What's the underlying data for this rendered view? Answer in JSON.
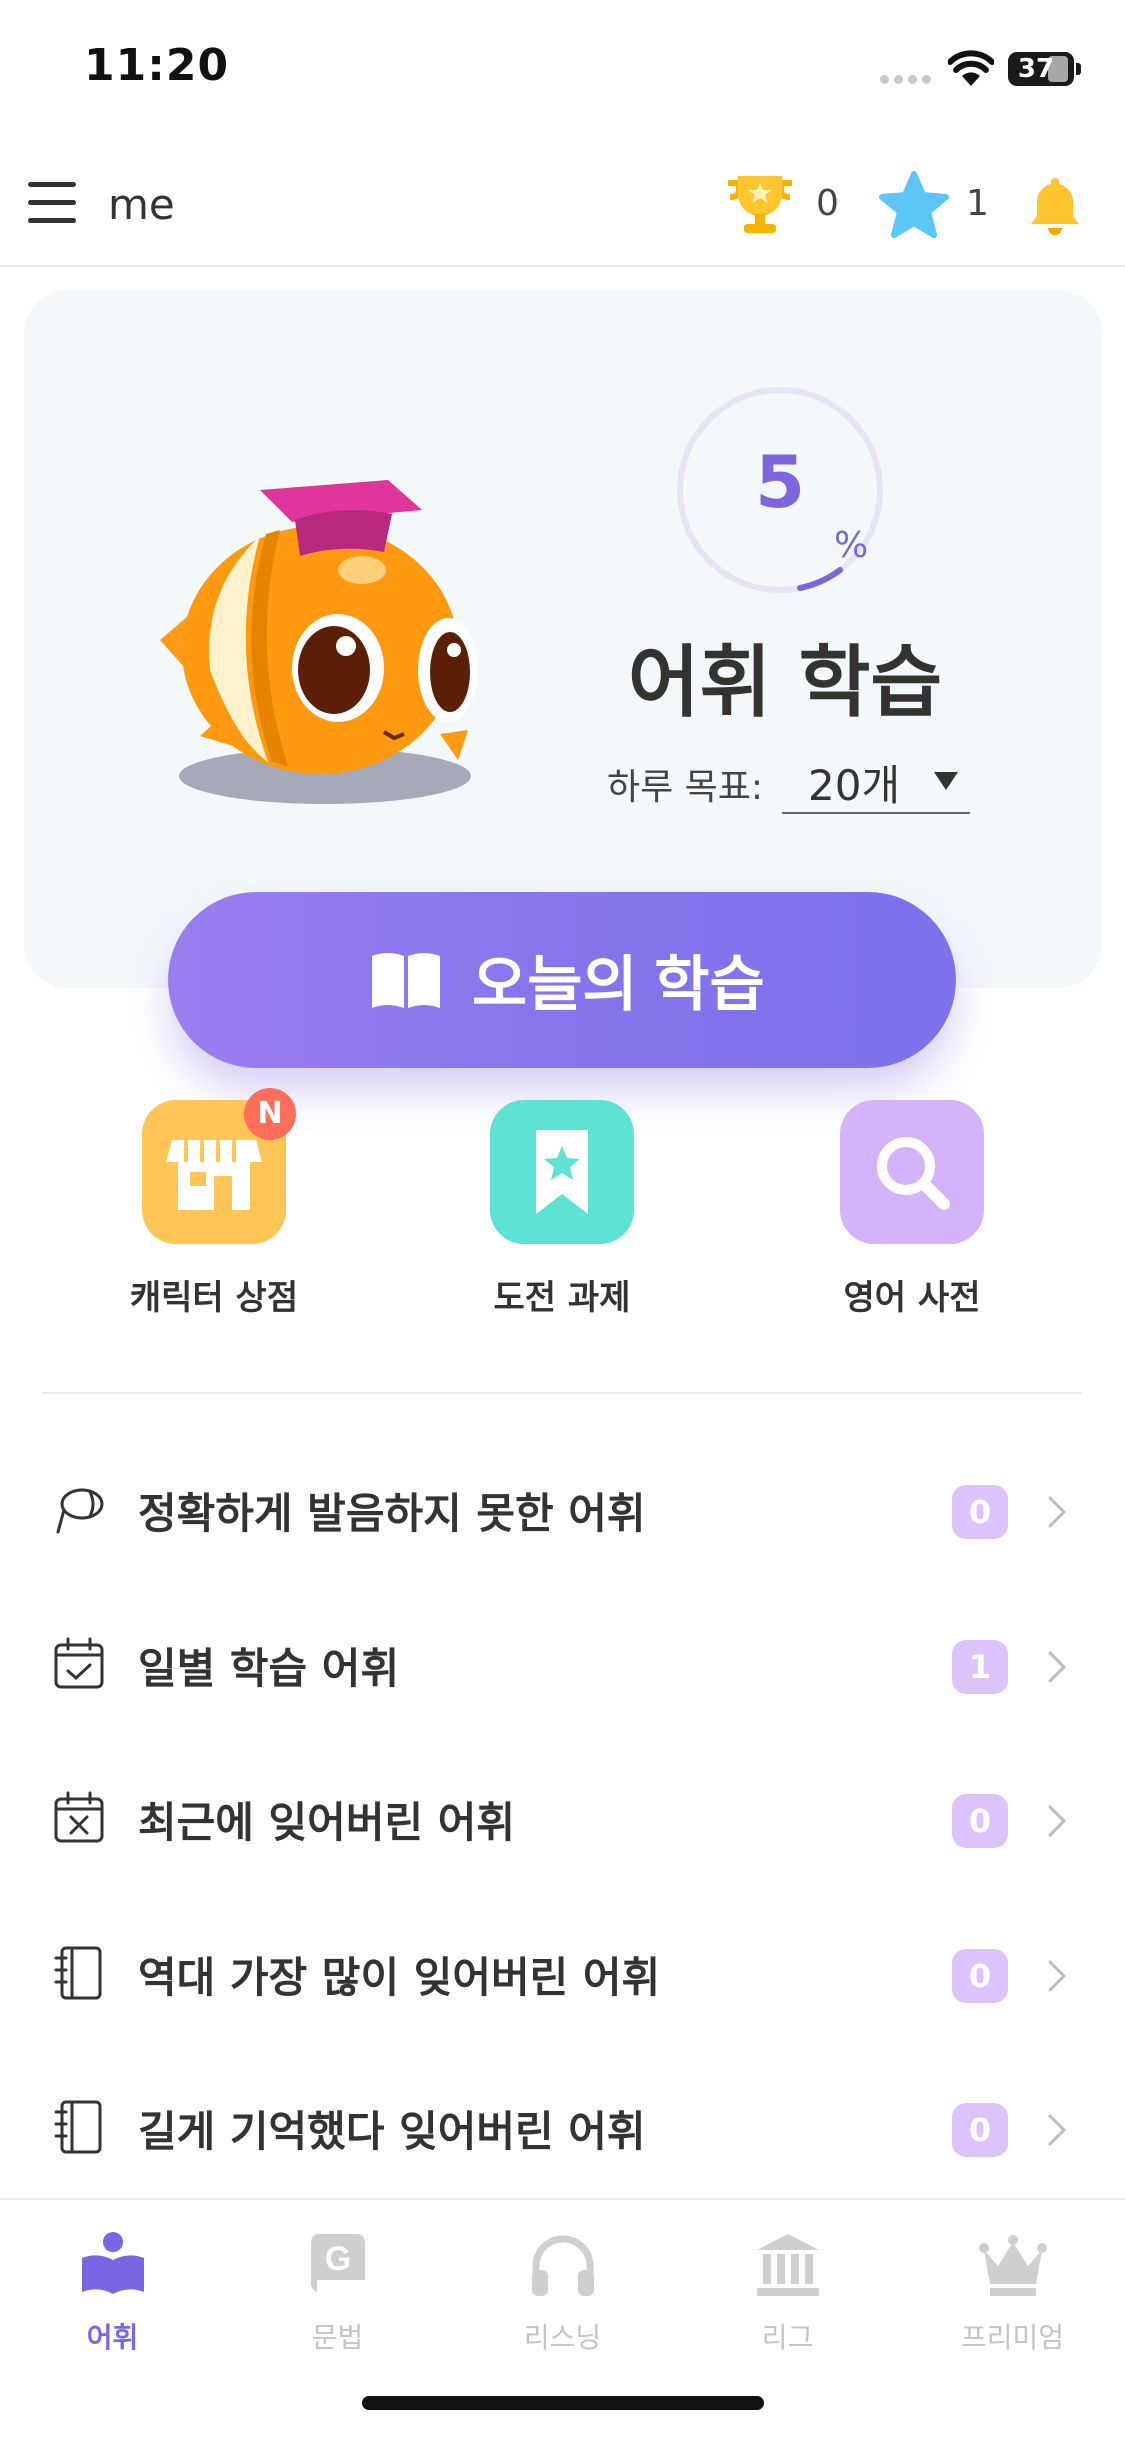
{
  "status": {
    "time": "11:20",
    "battery": "37"
  },
  "header": {
    "title": "me",
    "trophy_count": "0",
    "star_count": "1"
  },
  "hero": {
    "progress_number": "5",
    "progress_unit": "%",
    "progress_fraction": 0.05,
    "title": "어휘 학습",
    "goal_label": "하루 목표:",
    "goal_value": "20개"
  },
  "cta": {
    "label": "오늘의 학습"
  },
  "tiles": [
    {
      "label": "캐릭터 상점",
      "badge": "N"
    },
    {
      "label": "도전 과제"
    },
    {
      "label": "영어 사전"
    }
  ],
  "list": [
    {
      "label": "정확하게 발음하지 못한 어휘",
      "count": "0"
    },
    {
      "label": "일별 학습 어휘",
      "count": "1"
    },
    {
      "label": "최근에 잊어버린 어휘",
      "count": "0"
    },
    {
      "label": "역대 가장 많이 잊어버린 어휘",
      "count": "0"
    },
    {
      "label": "길게 기억했다 잊어버린 어휘",
      "count": "0"
    }
  ],
  "tabs": [
    {
      "label": "어휘",
      "active": true
    },
    {
      "label": "문법"
    },
    {
      "label": "리스닝"
    },
    {
      "label": "리그"
    },
    {
      "label": "프리미엄"
    }
  ],
  "colors": {
    "accent": "#7a66e3",
    "badge": "#dcc3fb",
    "cta_start": "#9a7ef0",
    "cta_end": "#7c72ec"
  },
  "icons": [
    "menu-icon",
    "trophy-icon",
    "star-icon",
    "bell-icon",
    "book-icon",
    "store-icon",
    "bookmark-star-icon",
    "search-icon",
    "microphone-icon",
    "calendar-check-icon",
    "calendar-x-icon",
    "notebook-icon",
    "chevron-right-icon"
  ]
}
